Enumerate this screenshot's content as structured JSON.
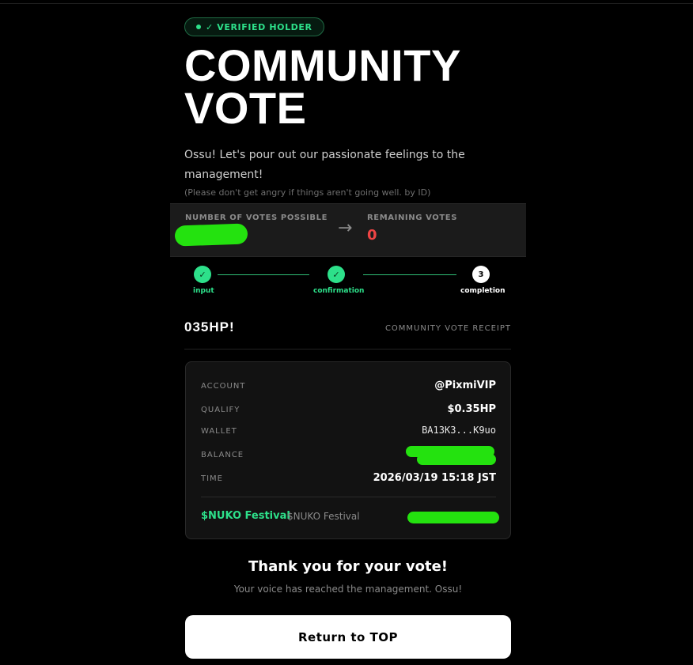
{
  "badge": {
    "label": "✓ VERIFIED HOLDER"
  },
  "hero": {
    "title_line1": "COMMUNITY",
    "title_line2": "VOTE",
    "description": "Ossu! Let's pour out our passionate feelings to the management!",
    "note": "(Please don't get angry if things aren't going well. by ID)"
  },
  "votes": {
    "possible_label": "NUMBER OF VOTES POSSIBLE",
    "remaining_label": "REMAINING VOTES",
    "remaining_value": "0",
    "arrow": "→"
  },
  "steps": [
    {
      "number": "✓",
      "label": "input",
      "state": "done"
    },
    {
      "number": "✓",
      "label": "confirmation",
      "state": "done"
    },
    {
      "number": "3",
      "label": "completion",
      "state": "current"
    }
  ],
  "receipt": {
    "code": "035HP!",
    "tag": "COMMUNITY VOTE RECEIPT",
    "rows": [
      {
        "label": "ACCOUNT",
        "value": "@PixmiVIP"
      },
      {
        "label": "QUALIFY",
        "value": "$0.35HP"
      },
      {
        "label": "WALLET",
        "value": "BA13K3...K9uo"
      },
      {
        "label": "BALANCE",
        "value": ""
      },
      {
        "label": "TIME",
        "value": "2026/03/19 15:18 JST"
      }
    ],
    "token": {
      "name": "$NUKO Festival",
      "sub": "$NUKO Festival"
    }
  },
  "thanks": {
    "title": "Thank you for your vote!",
    "subtitle": "Your voice has reached the management. Ossu!"
  },
  "return_button": {
    "label": "Return to TOP"
  },
  "colors": {
    "accent": "#2de08a",
    "danger": "#ef4444",
    "redaction": "#24e20f"
  }
}
